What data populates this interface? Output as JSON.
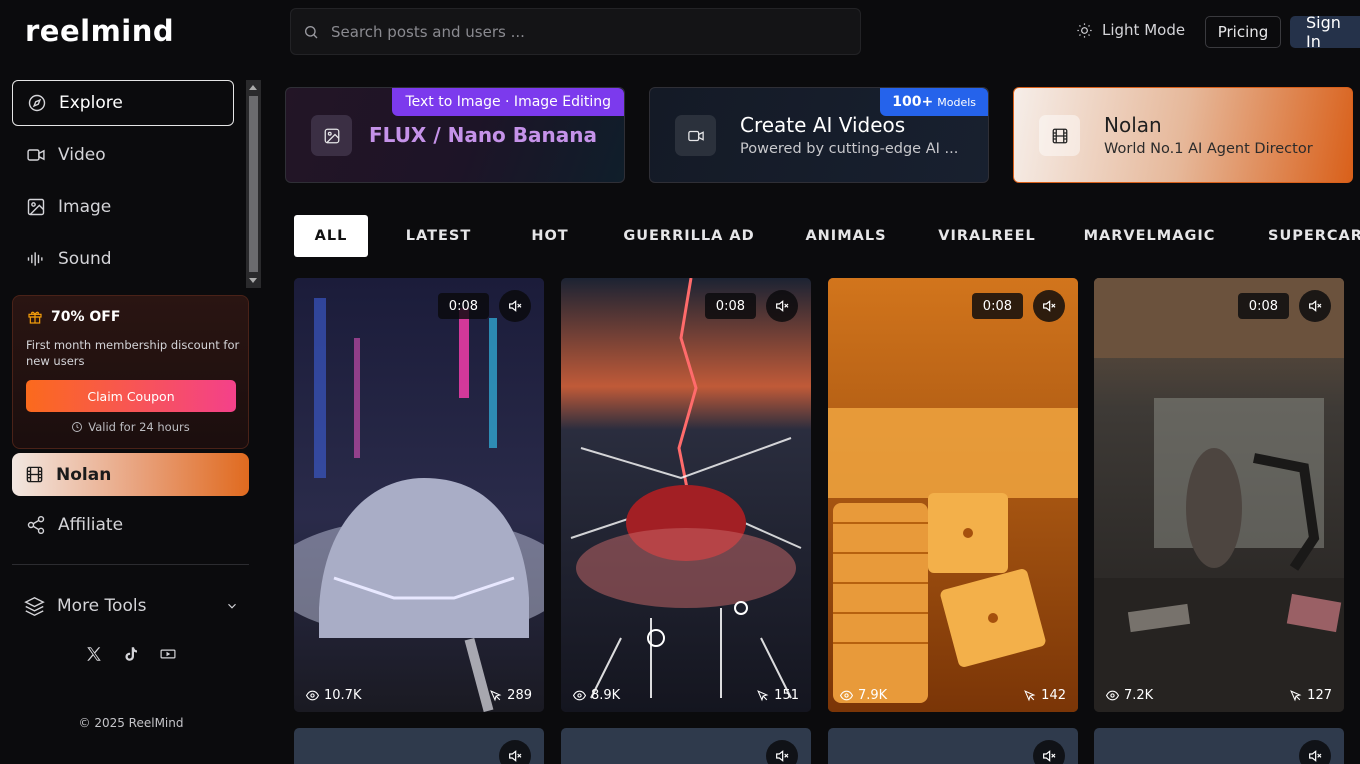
{
  "brand": {
    "logo": "reelmind"
  },
  "sidebar": {
    "items": [
      {
        "label": "Explore",
        "icon": "compass-icon"
      },
      {
        "label": "Video",
        "icon": "video-camera-icon"
      },
      {
        "label": "Image",
        "icon": "image-icon"
      },
      {
        "label": "Sound",
        "icon": "sound-wave-icon"
      }
    ],
    "coupon": {
      "title": "70% OFF",
      "description": "First month membership discount for new users",
      "button": "Claim Coupon",
      "validity": "Valid for 24 hours"
    },
    "nolan": {
      "label": "Nolan",
      "icon": "film-icon"
    },
    "affiliate": {
      "label": "Affiliate",
      "icon": "share-icon"
    },
    "more_tools": {
      "label": "More Tools"
    },
    "socials": [
      "x-icon",
      "tiktok-icon",
      "youtube-icon"
    ],
    "copyright": "© 2025 ReelMind"
  },
  "header": {
    "search_placeholder": "Search posts and users ...",
    "light_mode": "Light Mode",
    "pricing": "Pricing",
    "sign_in": "Sign In"
  },
  "promos": [
    {
      "tag": "Text to Image · Image Editing",
      "title": "FLUX / Nano Banana"
    },
    {
      "tag_bold": "100+",
      "tag_small": "Models",
      "title": "Create AI Videos",
      "subtitle": "Powered by cutting-edge AI ..."
    },
    {
      "title": "Nolan",
      "subtitle": "World No.1 AI Agent Director"
    }
  ],
  "tabs": [
    "ALL",
    "LATEST",
    "HOT",
    "GUERRILLA AD",
    "ANIMALS",
    "VIRALREEL",
    "MARVELMAGIC",
    "SUPERCAR"
  ],
  "videos": [
    {
      "duration": "0:08",
      "views": "10.7K",
      "clicks": "289"
    },
    {
      "duration": "0:08",
      "views": "8.9K",
      "clicks": "151"
    },
    {
      "duration": "0:08",
      "views": "7.9K",
      "clicks": "142"
    },
    {
      "duration": "0:08",
      "views": "7.2K",
      "clicks": "127"
    }
  ],
  "colors": {
    "background": "#0b0b0d",
    "accent_purple": "#7c3aed",
    "accent_blue": "#2563eb",
    "accent_orange": "#e06a1f"
  }
}
